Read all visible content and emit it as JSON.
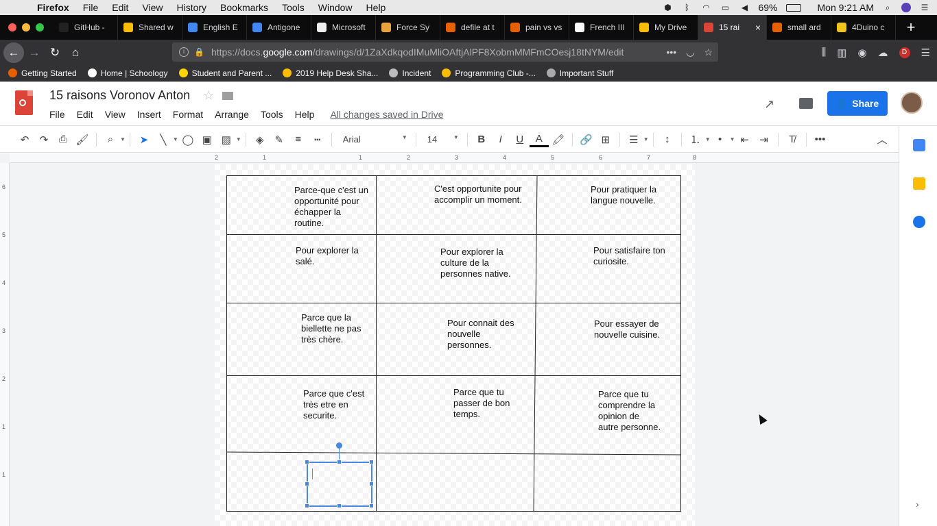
{
  "menubar": {
    "app": "Firefox",
    "items": [
      "File",
      "Edit",
      "View",
      "History",
      "Bookmarks",
      "Tools",
      "Window",
      "Help"
    ],
    "battery": "69%",
    "clock": "Mon 9:21 AM"
  },
  "tabs": [
    {
      "label": "GitHub -",
      "icon": "github-icon",
      "color": "#222222"
    },
    {
      "label": "Shared w",
      "icon": "drive-icon",
      "color": "#fbbc04"
    },
    {
      "label": "English E",
      "icon": "docs-icon",
      "color": "#4285f4"
    },
    {
      "label": "Antigone",
      "icon": "docs-icon",
      "color": "#4285f4"
    },
    {
      "label": "Microsoft",
      "icon": "page-icon",
      "color": "#eeeeee"
    },
    {
      "label": "Force Sy",
      "icon": "orange-icon",
      "color": "#e8a33d"
    },
    {
      "label": "defile at t",
      "icon": "firefox-icon",
      "color": "#e66000"
    },
    {
      "label": "pain vs vs",
      "icon": "firefox-icon",
      "color": "#e66000"
    },
    {
      "label": "French III",
      "icon": "schoology-icon",
      "color": "#ffffff"
    },
    {
      "label": "My Drive",
      "icon": "drive-icon",
      "color": "#fbbc04"
    },
    {
      "label": "15 rai",
      "icon": "drawings-icon",
      "color": "#db4437",
      "active": true
    },
    {
      "label": "small ard",
      "icon": "firefox-icon",
      "color": "#e66000"
    },
    {
      "label": "4Duino c",
      "icon": "4duino-icon",
      "color": "#f0c419"
    }
  ],
  "url": {
    "prefix": "https://docs.",
    "domain": "google.com",
    "suffix": "/drawings/d/1ZaXdkqodIMuMliOAftjAlPF8XobmMMFmCOesj18tNYM/edit"
  },
  "bookmarks": [
    {
      "label": "Getting Started",
      "color": "#e66000"
    },
    {
      "label": "Home | Schoology",
      "color": "#ffffff"
    },
    {
      "label": "Student and Parent ...",
      "color": "#ffd400"
    },
    {
      "label": "2019 Help Desk Sha...",
      "color": "#fbbc04"
    },
    {
      "label": "Incident",
      "color": "#bbbbbb"
    },
    {
      "label": "Programming Club -...",
      "color": "#fbbc04"
    },
    {
      "label": "Important Stuff",
      "color": "#aaaaaa"
    }
  ],
  "doc": {
    "title": "15 raisons Voronov Anton",
    "menu": [
      "File",
      "Edit",
      "View",
      "Insert",
      "Format",
      "Arrange",
      "Tools",
      "Help"
    ],
    "saved": "All changes saved in Drive",
    "share": "Share"
  },
  "toolbar": {
    "font": "Arial",
    "size": "14"
  },
  "ruler": {
    "h": [
      "2",
      "1",
      "1",
      "2",
      "3",
      "4",
      "5",
      "6",
      "7",
      "8"
    ],
    "v": [
      "6",
      "5",
      "4",
      "3",
      "2",
      "1",
      "1"
    ]
  },
  "cells": [
    [
      "Parce-que c'est un\nopportunité pour\néchapper la\nroutine.",
      "C'est opportunite pour\naccomplir un moment.",
      "Pour pratiquer la\nlangue nouvelle."
    ],
    [
      "Pour explorer la\nsalé.",
      "Pour explorer la\nculture de la\npersonnes native.",
      "Pour satisfaire ton\ncuriosite."
    ],
    [
      "Parce que la\nbiellette ne pas\ntrès chère.",
      "Pour connait des\nnouvelle\npersonnes.",
      "Pour essayer de\nnouvelle cuisine."
    ],
    [
      "Parce que c'est\ntrès etre en\nsecurite.",
      "Parce que tu\npasser de bon\ntemps.",
      "Parce que tu\ncomprendre la\nopinion de\nautre personne."
    ],
    [
      "",
      "",
      ""
    ]
  ]
}
